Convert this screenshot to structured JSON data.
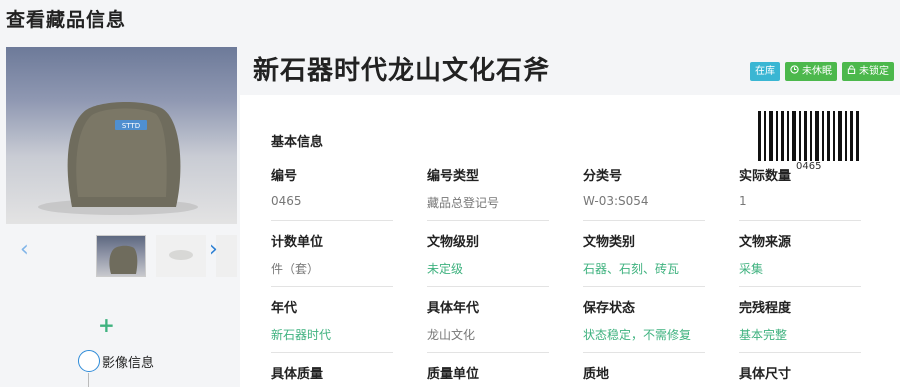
{
  "page": {
    "title": "查看藏品信息"
  },
  "gallery": {
    "prev_icon": "chevron-left-icon",
    "next_icon": "chevron-right-icon",
    "add_icon": "plus-icon",
    "image_info_label": "影像信息",
    "main_image_tag": "STTD"
  },
  "object": {
    "title": "新石器时代龙山文化石斧",
    "badges": [
      {
        "label": "在库",
        "color": "#3ab6d3"
      },
      {
        "label": "未休眠",
        "icon": "clock-icon",
        "color": "#4cb84c"
      },
      {
        "label": "未锁定",
        "icon": "lock-icon",
        "color": "#4cb84c"
      }
    ],
    "barcode_number": "0465"
  },
  "basic_info": {
    "section_title": "基本信息",
    "fields": [
      {
        "label": "编号",
        "value": "0465"
      },
      {
        "label": "编号类型",
        "value": "藏品总登记号"
      },
      {
        "label": "分类号",
        "value": "W-03:S054"
      },
      {
        "label": "实际数量",
        "value": "1"
      },
      {
        "label": "计数单位",
        "value": "件（套）"
      },
      {
        "label": "文物级别",
        "value": "未定级"
      },
      {
        "label": "文物类别",
        "value": "石器、石刻、砖瓦"
      },
      {
        "label": "文物来源",
        "value": "采集"
      },
      {
        "label": "年代",
        "value": "新石器时代"
      },
      {
        "label": "具体年代",
        "value": "龙山文化"
      },
      {
        "label": "保存状态",
        "value": "状态稳定，不需修复"
      },
      {
        "label": "完残程度",
        "value": "基本完整"
      },
      {
        "label": "具体质量",
        "value": ""
      },
      {
        "label": "质量单位",
        "value": ""
      },
      {
        "label": "质地",
        "value": ""
      },
      {
        "label": "具体尺寸",
        "value": ""
      }
    ]
  },
  "colors": {
    "accent_green": "#3fb27f",
    "accent_blue": "#2e8bd8"
  }
}
